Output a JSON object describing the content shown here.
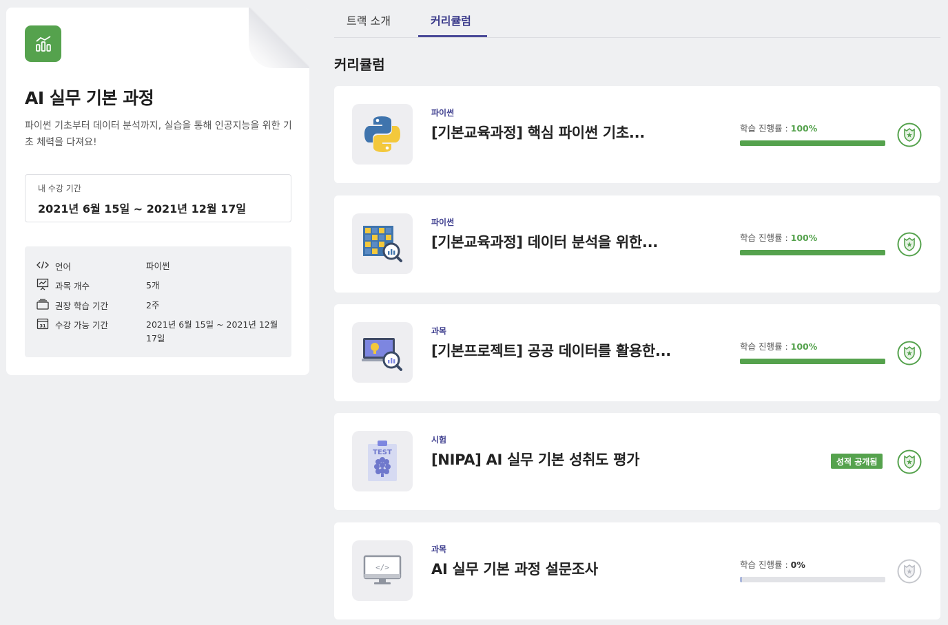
{
  "track": {
    "title": "AI 실무 기본 과정",
    "description": "파이썬 기초부터 데이터 분석까지, 실습을 통해 인공지능을 위한 기초 체력을 다져요!",
    "period_label": "내 수강 기간",
    "period_value": "2021년 6월 15일 ~ 2021년 12월 17일",
    "info": [
      {
        "icon": "code-icon",
        "label": "언어",
        "value": "파이썬"
      },
      {
        "icon": "presentation-chart-icon",
        "label": "과목 개수",
        "value": "5개"
      },
      {
        "icon": "stack-icon",
        "label": "권장 학습 기간",
        "value": "2주"
      },
      {
        "icon": "calendar-icon",
        "label": "수강 가능 기간",
        "value": "2021년 6월 15일 ~ 2021년 12월 17일"
      }
    ],
    "calendar_day": "31"
  },
  "tabs": [
    {
      "label": "트랙 소개",
      "active": false
    },
    {
      "label": "커리큘럼",
      "active": true
    }
  ],
  "section_title": "커리큘럼",
  "progress_prefix": "학습 진행률 : ",
  "courses": [
    {
      "category": "파이썬",
      "title": "[기본교육과정] 핵심 파이썬 기초...",
      "progress": "100%",
      "progress_value": 100,
      "icon": "python-logo-icon",
      "shield_done": true
    },
    {
      "category": "파이썬",
      "title": "[기본교육과정] 데이터 분석을 위한...",
      "progress": "100%",
      "progress_value": 100,
      "icon": "data-table-search-icon",
      "shield_done": true
    },
    {
      "category": "과목",
      "title": "[기본프로젝트] 공공 데이터를 활용한...",
      "progress": "100%",
      "progress_value": 100,
      "icon": "monitor-analysis-icon",
      "shield_done": true
    },
    {
      "category": "시험",
      "title": "[NIPA] AI 실무 기본 성취도 평가",
      "badge": "성적 공개됨",
      "icon": "test-brain-icon",
      "test_label": "TEST",
      "shield_done": true
    },
    {
      "category": "과목",
      "title": "AI 실무 기본 과정 설문조사",
      "progress": "0%",
      "progress_value": 0,
      "icon": "monitor-code-icon",
      "monitor_text": "</>",
      "shield_done": false
    }
  ],
  "colors": {
    "accent": "#55a24d",
    "tab_active": "#4b4b99",
    "category": "#3f3f8f",
    "background": "#eff0f2"
  }
}
